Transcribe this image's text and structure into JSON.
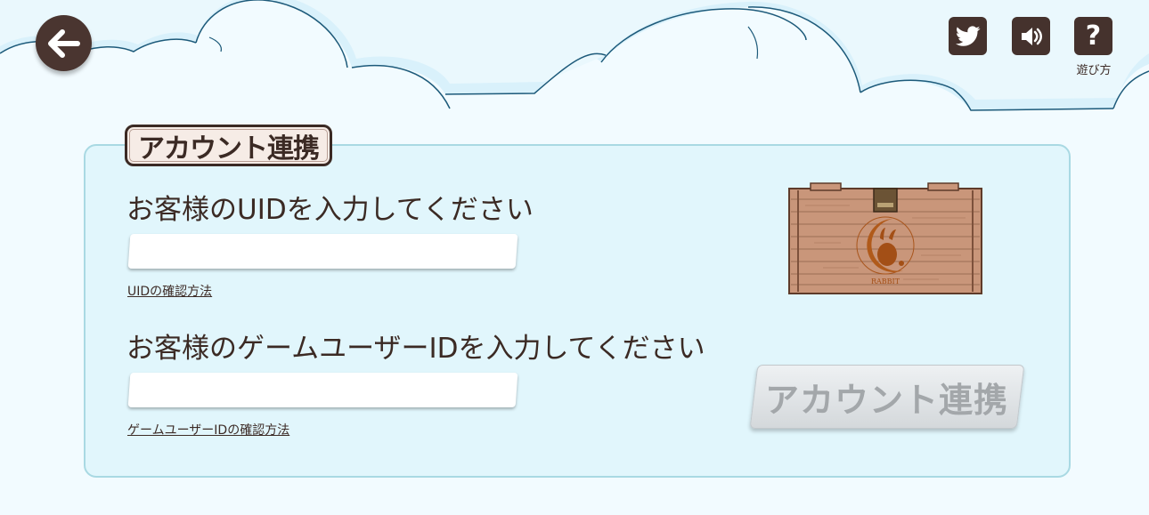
{
  "header": {
    "back_icon": "arrow-left-icon",
    "icons": {
      "twitter": "twitter-icon",
      "sound": "speaker-icon",
      "help": "question-icon"
    },
    "help_symbol": "?",
    "help_label": "遊び方"
  },
  "panel": {
    "title": "アカウント連携",
    "uid": {
      "label": "お客様のUIDを入力してください",
      "value": "",
      "help_link": "UIDの確認方法"
    },
    "game_user_id": {
      "label": "お客様のゲームユーザーIDを入力してください",
      "value": "",
      "help_link": "ゲームユーザーIDの確認方法"
    },
    "chest": {
      "icon": "treasure-chest-icon",
      "label": "RABBIT"
    },
    "submit_label": "アカウント連携"
  },
  "colors": {
    "dark_brown": "#45322d",
    "panel_bg": "#e1f6fc",
    "panel_border": "#a9d9e3",
    "page_bg": "#f2fbff",
    "cloud_outline": "#1d5a7a",
    "disabled_button": "#d4d8db"
  }
}
